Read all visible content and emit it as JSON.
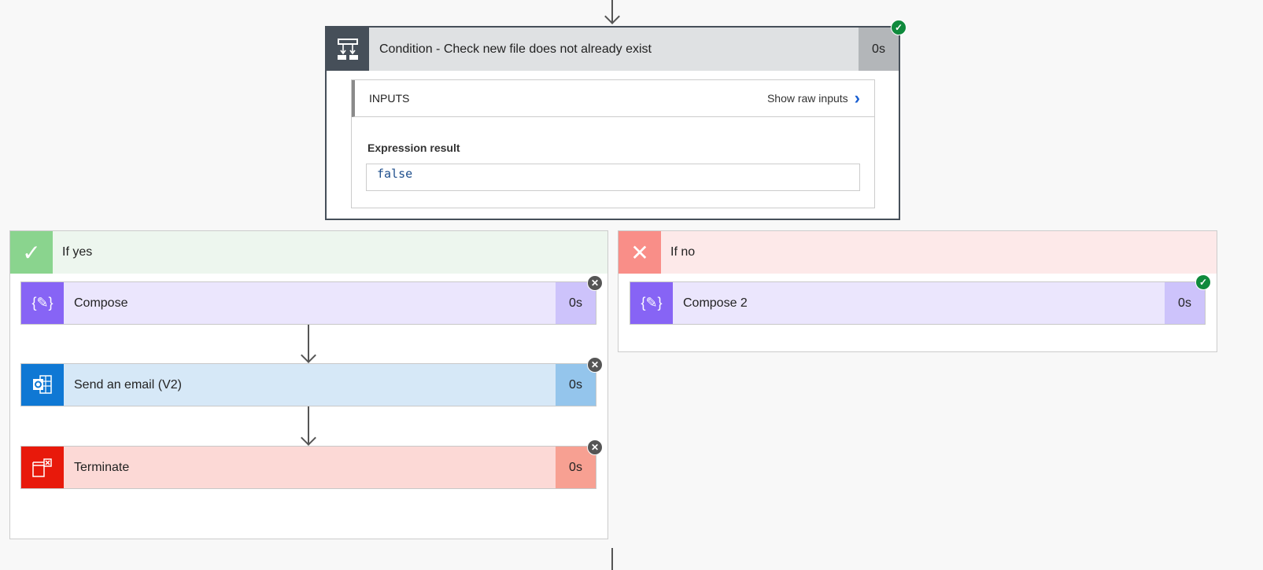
{
  "condition": {
    "title": "Condition - Check new file does not already exist",
    "duration": "0s",
    "status": "succeeded",
    "inputs_label": "INPUTS",
    "show_raw_inputs": "Show raw inputs",
    "expression_label": "Expression result",
    "expression_value": "false"
  },
  "if_yes": {
    "title": "If yes",
    "actions": [
      {
        "title": "Compose",
        "duration": "0s",
        "status": "skipped"
      },
      {
        "title": "Send an email (V2)",
        "duration": "0s",
        "status": "skipped"
      },
      {
        "title": "Terminate",
        "duration": "0s",
        "status": "skipped"
      }
    ]
  },
  "if_no": {
    "title": "If no",
    "actions": [
      {
        "title": "Compose 2",
        "duration": "0s",
        "status": "succeeded"
      }
    ]
  },
  "colors": {
    "success": "#0f8a3c",
    "compose": "#8764f5",
    "outlook": "#0f78d4",
    "terminate": "#e8190b"
  }
}
